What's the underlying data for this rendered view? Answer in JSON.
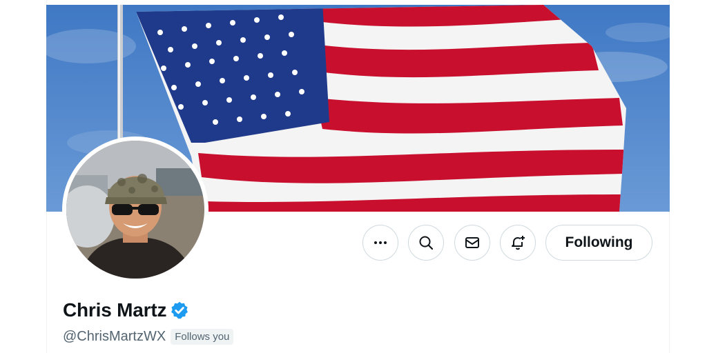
{
  "banner": {
    "image_name": "american-flag-banner"
  },
  "avatar": {
    "image_name": "profile-avatar"
  },
  "actions": {
    "more_icon": "more-icon",
    "search_icon": "search-icon",
    "message_icon": "envelope-icon",
    "notify_icon": "bell-plus-icon",
    "following_label": "Following"
  },
  "profile": {
    "name": "Chris Martz",
    "verified_icon": "verified-badge-icon",
    "handle": "@ChrisMartzWX",
    "follows_you": "Follows you"
  },
  "colors": {
    "text": "#0f1419",
    "secondary": "#536471",
    "border": "#cfd9de",
    "verified": "#1d9bf0",
    "flag_red": "#c8102e",
    "flag_blue": "#1f3a8a",
    "sky": "#4a82c9"
  }
}
